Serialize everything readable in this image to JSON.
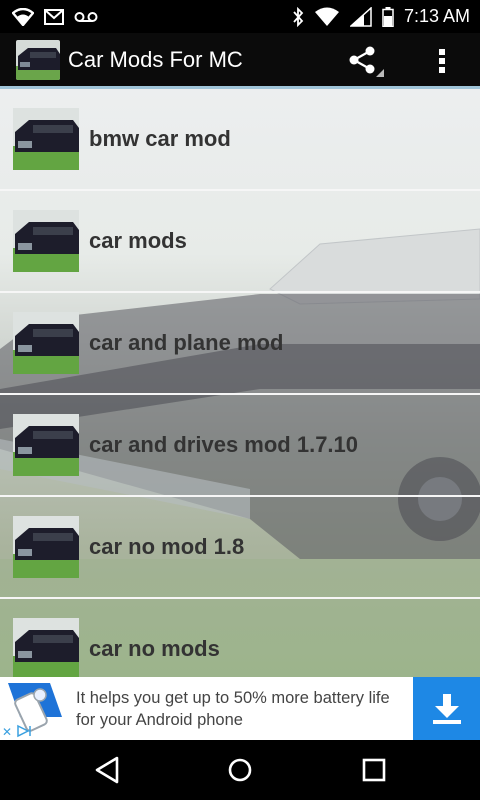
{
  "status_bar": {
    "time": "7:13 AM",
    "icons": [
      "wifi-icon",
      "gmail-icon",
      "voicemail-icon",
      "bluetooth-icon",
      "wifi-signal-icon",
      "cell-signal-icon",
      "battery-icon"
    ]
  },
  "action_bar": {
    "title": "Car Mods For MC",
    "icons": [
      "share-icon",
      "overflow-menu-icon"
    ]
  },
  "list": {
    "items": [
      {
        "label": "bmw car mod"
      },
      {
        "label": "car mods"
      },
      {
        "label": "car and plane mod"
      },
      {
        "label": "car and drives mod 1.7.10"
      },
      {
        "label": "car no mod 1.8"
      },
      {
        "label": "car no mods"
      }
    ]
  },
  "ad": {
    "text": "It helps you get up to 50% more battery life for your Android phone",
    "icons": [
      "battery-app-icon",
      "download-icon",
      "ad-choices-icon"
    ]
  },
  "nav_bar": {
    "icons": [
      "back-icon",
      "home-icon",
      "recents-icon"
    ]
  },
  "colors": {
    "accent": "#9fc4d8",
    "ad_button": "#1e88e5",
    "item_text": "#333333"
  }
}
